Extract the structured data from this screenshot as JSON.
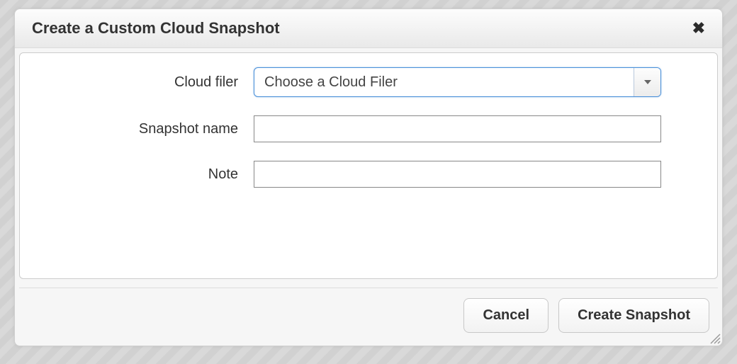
{
  "dialog": {
    "title": "Create a Custom Cloud Snapshot"
  },
  "form": {
    "cloud_filer": {
      "label": "Cloud filer",
      "selected": "Choose a Cloud Filer"
    },
    "snapshot_name": {
      "label": "Snapshot name",
      "value": ""
    },
    "note": {
      "label": "Note",
      "value": ""
    }
  },
  "footer": {
    "cancel_label": "Cancel",
    "create_label": "Create Snapshot"
  }
}
